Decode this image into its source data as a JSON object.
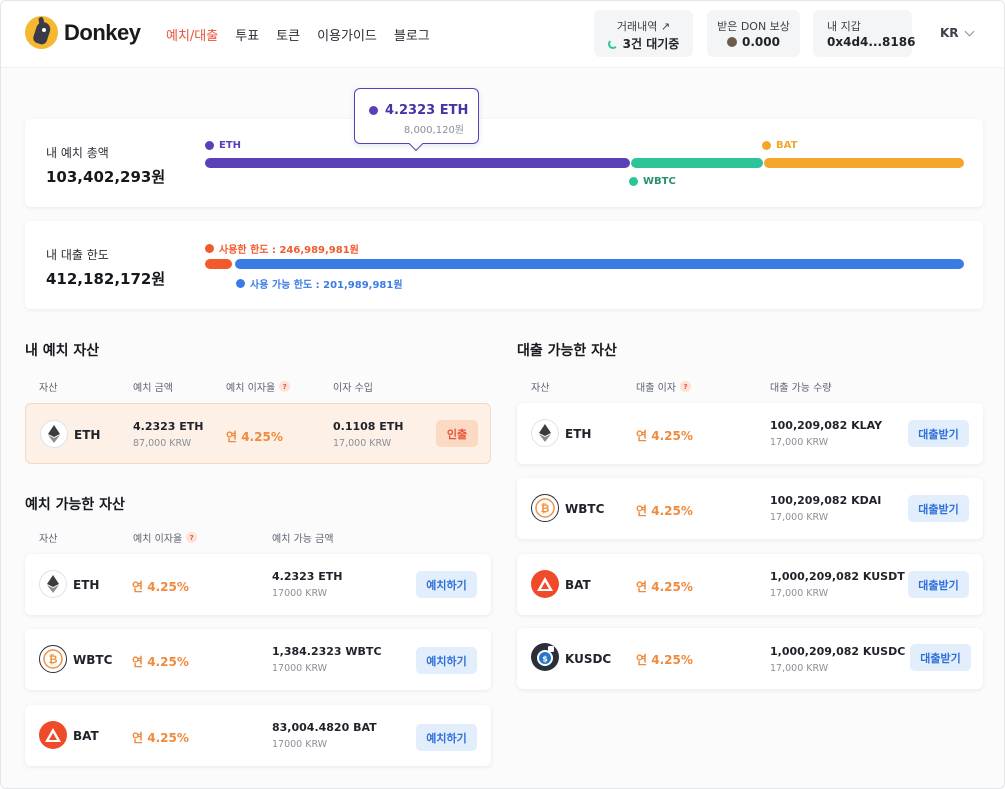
{
  "header": {
    "brand": "Donkey",
    "nav": [
      "예치/대출",
      "투표",
      "토큰",
      "이용가이드",
      "블로그"
    ],
    "history": {
      "label": "거래내역 ↗",
      "value": "3건 대기중"
    },
    "reward": {
      "label": "받은 DON 보상",
      "value": "0.000"
    },
    "wallet": {
      "label": "내 지갑",
      "value": "0x4d4...8186"
    },
    "lang": "KR"
  },
  "deposit_summary": {
    "title": "내 예치 총액",
    "amount": "103,402,293원",
    "legend": {
      "eth": "ETH",
      "wbtc": "WBTC",
      "bat": "BAT"
    },
    "tooltip": {
      "amount": "4.2323 ETH",
      "krw": "8,000,120원"
    },
    "colors": {
      "eth": "#5b3fb8",
      "wbtc": "#2ec49a",
      "bat": "#f5a52a"
    }
  },
  "loan_summary": {
    "title": "내 대출 한도",
    "amount": "412,182,172원",
    "used_label": "사용한 한도 : 246,989,981원",
    "available_label": "사용 가능 한도 : 201,989,981원",
    "colors": {
      "used": "#f35a2b",
      "available": "#3a7be6"
    }
  },
  "my_deposits": {
    "title": "내 예치 자산",
    "headers": [
      "자산",
      "예치 금액",
      "예치 이자율",
      "이자 수입"
    ],
    "rows": [
      {
        "name": "ETH",
        "amount": "4.2323 ETH",
        "amount_krw": "87,000 KRW",
        "rate": "연 4.25%",
        "interest": "0.1108 ETH",
        "interest_krw": "17,000 KRW",
        "action": "인출"
      }
    ]
  },
  "depositable": {
    "title": "예치 가능한 자산",
    "headers": [
      "자산",
      "예치 이자율",
      "예치 가능 금액"
    ],
    "rows": [
      {
        "name": "ETH",
        "rate": "연 4.25%",
        "amount": "4.2323 ETH",
        "amount_krw": "17000 KRW",
        "action": "예치하기"
      },
      {
        "name": "WBTC",
        "rate": "연 4.25%",
        "amount": "1,384.2323 WBTC",
        "amount_krw": "17000 KRW",
        "action": "예치하기"
      },
      {
        "name": "BAT",
        "rate": "연 4.25%",
        "amount": "83,004.4820 BAT",
        "amount_krw": "17000 KRW",
        "action": "예치하기"
      }
    ]
  },
  "borrowable": {
    "title": "대출 가능한 자산",
    "headers": [
      "자산",
      "대출 이자",
      "대출 가능 수량"
    ],
    "rows": [
      {
        "name": "ETH",
        "rate": "연 4.25%",
        "amount": "100,209,082 KLAY",
        "amount_krw": "17,000 KRW",
        "action": "대출받기"
      },
      {
        "name": "WBTC",
        "rate": "연 4.25%",
        "amount": "100,209,082 KDAI",
        "amount_krw": "17,000 KRW",
        "action": "대출받기"
      },
      {
        "name": "BAT",
        "rate": "연 4.25%",
        "amount": "1,000,209,082 KUSDT",
        "amount_krw": "17,000 KRW",
        "action": "대출받기"
      },
      {
        "name": "KUSDC",
        "rate": "연 4.25%",
        "amount": "1,000,209,082 KUSDC",
        "amount_krw": "17,000 KRW",
        "action": "대출받기"
      }
    ]
  }
}
